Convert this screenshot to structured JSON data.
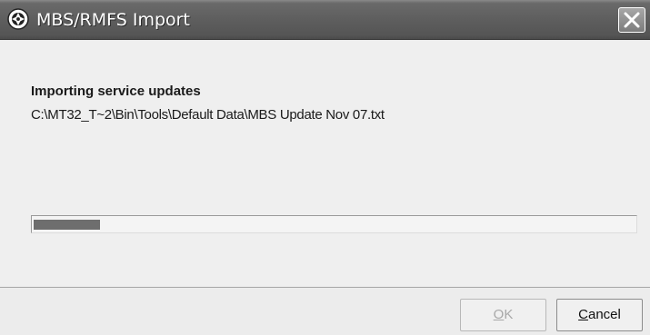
{
  "window": {
    "title": "MBS/RMFS Import",
    "icon": "app-logo-icon"
  },
  "content": {
    "heading": "Importing service updates",
    "file_path": "C:\\MT32_T~2\\Bin\\Tools\\Default Data\\MBS Update Nov 07.txt"
  },
  "progress": {
    "fraction": 0.11
  },
  "buttons": {
    "ok_label": "OK",
    "ok_enabled": false,
    "cancel_label": "Cancel"
  },
  "colors": {
    "titlebar": "#5e5e5e",
    "progress_fill": "#6e6e6e",
    "disabled_text": "#a8a8a8"
  }
}
